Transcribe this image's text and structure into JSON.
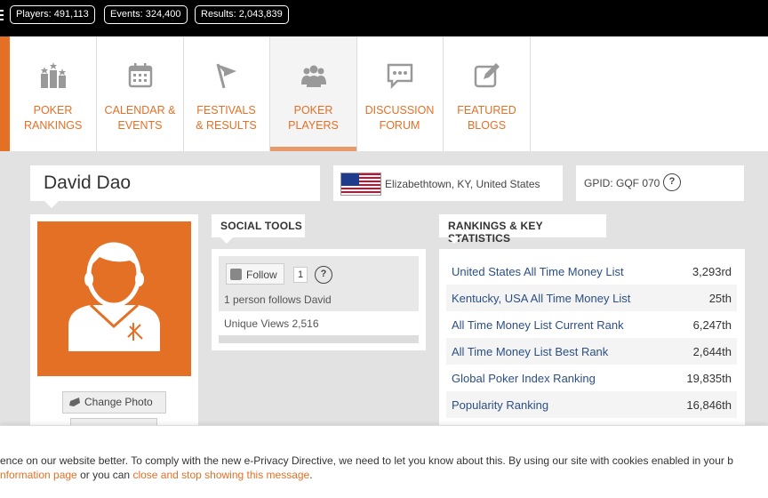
{
  "topbar": {
    "players": "Players: 491,113",
    "events": "Events: 324,400",
    "results": "Results: 2,043,839"
  },
  "nav": {
    "items": [
      {
        "label": "POKER RANKINGS",
        "icon": "rankings-podium-icon"
      },
      {
        "label": "CALENDAR & EVENTS",
        "icon": "calendar-icon"
      },
      {
        "label": "FESTIVALS & RESULTS",
        "icon": "flag-icon"
      },
      {
        "label": "POKER PLAYERS",
        "icon": "players-group-icon",
        "active": true
      },
      {
        "label": "DISCUSSION FORUM",
        "icon": "chat-bubble-icon"
      },
      {
        "label": "FEATURED BLOGS",
        "icon": "edit-blog-icon"
      }
    ]
  },
  "profile": {
    "name": "David Dao",
    "location": "Elizabethtown, KY, United States",
    "gpid": "GPID: GQF 070",
    "change_photo": "Change Photo"
  },
  "social": {
    "title": "SOCIAL TOOLS",
    "follow_label": "Follow",
    "follow_count": "1",
    "follows_text": "1 person follows David",
    "views_text": "Unique Views 2,516"
  },
  "rankings": {
    "title": "RANKINGS & KEY STATISTICS",
    "rows": [
      {
        "label": "United States All Time Money List",
        "value": "3,293rd"
      },
      {
        "label": "Kentucky, USA All Time Money List",
        "value": "25th"
      },
      {
        "label": "All Time Money List Current Rank",
        "value": "6,247th"
      },
      {
        "label": "All Time Money List Best Rank",
        "value": "2,644th"
      },
      {
        "label": "Global Poker Index Ranking",
        "value": "19,835th"
      },
      {
        "label": "Popularity Ranking",
        "value": "16,846th"
      }
    ]
  },
  "cookie": {
    "line1": "ence on our website better. To comply with the new e-Privacy Directive, we need to let you know about this. By using our site with cookies enabled in your b",
    "line2_link1": "nformation page",
    "line2_mid": " or you can ",
    "line2_link2": "close and stop showing this message",
    "line2_end": "."
  },
  "colors": {
    "accent": "#e47026",
    "link": "#2b4f86"
  }
}
